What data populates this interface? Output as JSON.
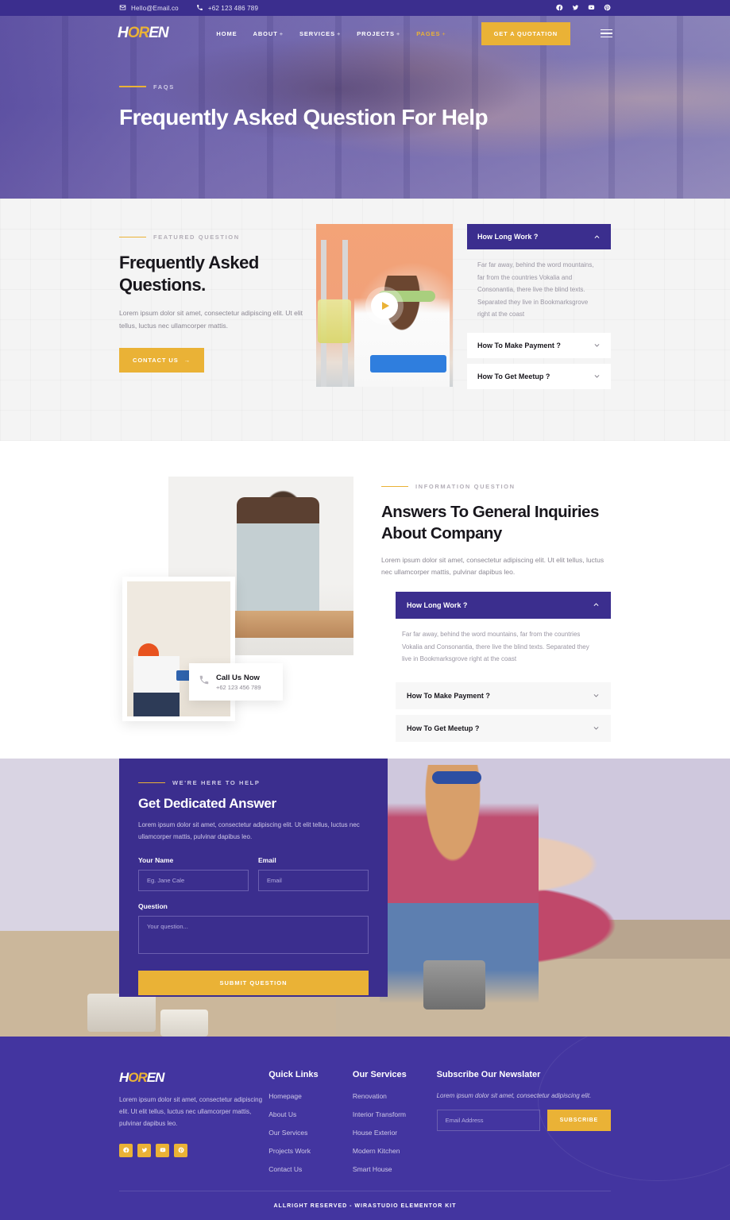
{
  "topbar": {
    "email": "Hello@Email.co",
    "phone": "+62 123 486 789",
    "social": [
      "facebook-icon",
      "twitter-icon",
      "youtube-icon",
      "pinterest-icon"
    ]
  },
  "nav": {
    "logo_a": "H",
    "logo_b": "OR",
    "logo_c": "EN",
    "items": [
      {
        "label": "HOME",
        "has_submenu": false,
        "active": false
      },
      {
        "label": "ABOUT",
        "has_submenu": true,
        "active": false
      },
      {
        "label": "SERVICES",
        "has_submenu": true,
        "active": false
      },
      {
        "label": "PROJECTS",
        "has_submenu": true,
        "active": false
      },
      {
        "label": "PAGES",
        "has_submenu": true,
        "active": true
      }
    ],
    "quote_button": "GET A QUOTATION"
  },
  "hero": {
    "eyebrow": "FAQS",
    "title": "Frequently Asked Question For Help"
  },
  "faq_featured": {
    "eyebrow": "FEATURED QUESTION",
    "title": "Frequently Asked Questions.",
    "desc": "Lorem ipsum dolor sit amet, consectetur adipiscing elit. Ut elit tellus, luctus nec ullamcorper mattis.",
    "button": "CONTACT US",
    "button_arrow": "→",
    "accordion": [
      {
        "q": "How Long Work ?",
        "a": "Far far away, behind the word mountains, far from the countries Vokalia and Consonantia, there live the blind texts. Separated they live in Bookmarksgrove right at the coast",
        "open": true
      },
      {
        "q": "How To Make Payment ?",
        "a": "",
        "open": false
      },
      {
        "q": "How To Get Meetup ?",
        "a": "",
        "open": false
      }
    ]
  },
  "faq_info": {
    "eyebrow": "INFORMATION QUESTION",
    "title": "Answers To General Inquiries About Company",
    "desc": "Lorem ipsum dolor sit amet, consectetur adipiscing elit. Ut elit tellus, luctus nec ullamcorper mattis, pulvinar dapibus leo.",
    "call_title": "Call Us Now",
    "call_phone": "+62 123 456 789",
    "accordion": [
      {
        "q": "How Long Work ?",
        "a": "Far far away, behind the word mountains, far from the countries Vokalia and Consonantia, there live the blind texts. Separated they live in Bookmarksgrove right at the coast",
        "open": true
      },
      {
        "q": "How To Make Payment ?",
        "a": "",
        "open": false
      },
      {
        "q": "How To Get Meetup ?",
        "a": "",
        "open": false
      }
    ]
  },
  "contact": {
    "eyebrow": "WE'RE HERE TO HELP",
    "title": "Get Dedicated Answer",
    "desc": "Lorem ipsum dolor sit amet, consectetur adipiscing elit. Ut elit tellus, luctus nec ullamcorper mattis, pulvinar dapibus leo.",
    "name_label": "Your Name",
    "name_placeholder": "Eg. Jane Cale",
    "email_label": "Email",
    "email_placeholder": "Email",
    "question_label": "Question",
    "question_placeholder": "Your question...",
    "submit": "SUBMIT QUESTION"
  },
  "footer": {
    "logo_a": "H",
    "logo_b": "OR",
    "logo_c": "EN",
    "desc": "Lorem ipsum dolor sit amet, consectetur adipiscing elit. Ut elit tellus, luctus nec ullamcorper mattis, pulvinar dapibus leo.",
    "social": [
      "facebook-icon",
      "twitter-icon",
      "youtube-icon",
      "pinterest-icon"
    ],
    "quick_links_title": "Quick Links",
    "quick_links": [
      "Homepage",
      "About Us",
      "Our Services",
      "Projects Work",
      "Contact Us"
    ],
    "services_title": "Our Services",
    "services": [
      "Renovation",
      "Interior Transform",
      "House Exterior",
      "Modern Kitchen",
      "Smart House"
    ],
    "newsletter_title": "Subscribe Our Newslater",
    "newsletter_desc": "Lorem ipsum dolor sit amet, consectetur adipiscing elit.",
    "newsletter_placeholder": "Email Address",
    "newsletter_button": "SUBSCRIBE",
    "copyright": "ALLRIGHT RESERVED - WIRASTUDIO ELEMENTOR KIT"
  },
  "colors": {
    "purple": "#3b2e8e",
    "purple_footer": "#4335a0",
    "yellow": "#eab236",
    "dark": "#18161c",
    "grey_text": "#8b8792"
  }
}
